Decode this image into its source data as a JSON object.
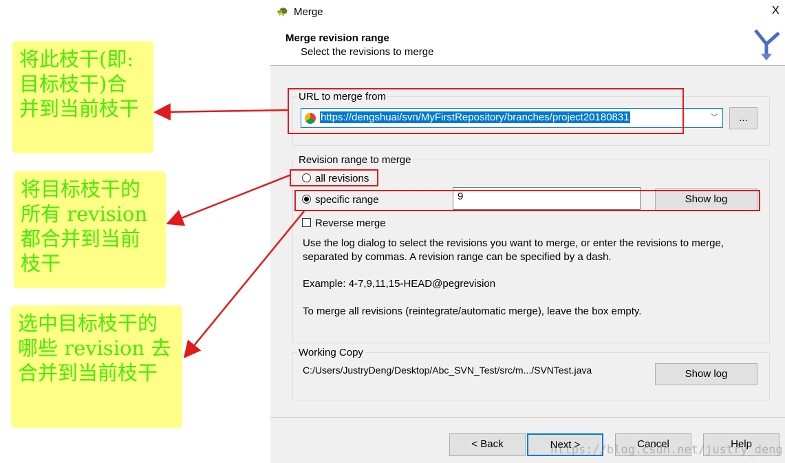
{
  "window": {
    "title": "Merge",
    "close": "X"
  },
  "header": {
    "title": "Merge revision range",
    "subtitle": "Select the revisions to merge"
  },
  "url_group": {
    "label": "URL to merge from",
    "value": "https://dengshuai/svn/MyFirstRepository/branches/project20180831",
    "browse": "..."
  },
  "range_group": {
    "label": "Revision range to merge",
    "all_revisions": "all revisions",
    "specific_range": "specific range",
    "range_value": "9",
    "show_log": "Show log",
    "reverse_merge": "Reverse merge",
    "help1": "Use the log dialog to select the revisions you want to merge, or enter the revisions to merge, separated by commas. A revision range can be specified by a dash.",
    "example": "Example: 4-7,9,11,15-HEAD@pegrevision",
    "help2": "To merge all revisions (reintegrate/automatic merge), leave the box empty.",
    "selected": "specific range"
  },
  "wc_group": {
    "label": "Working Copy",
    "path": "C:/Users/JustryDeng/Desktop/Abc_SVN_Test/src/m.../SVNTest.java",
    "show_log": "Show log"
  },
  "buttons": {
    "back": "< Back",
    "next": "Next >",
    "cancel": "Cancel",
    "help": "Help"
  },
  "watermark": "https://blog.csdn.net/justry_deng",
  "notes": [
    "将此枝干(即:目标枝干)合并到当前枝干",
    "将目标枝干的所有 revision 都合并到当前枝干",
    "选中目标枝干的 哪些 revision 去合并到当前枝干"
  ],
  "colors": {
    "annotation": "#e21a1a",
    "note_bg": "#ffff88",
    "note_text": "#44ee00",
    "selection": "#0078d7"
  }
}
